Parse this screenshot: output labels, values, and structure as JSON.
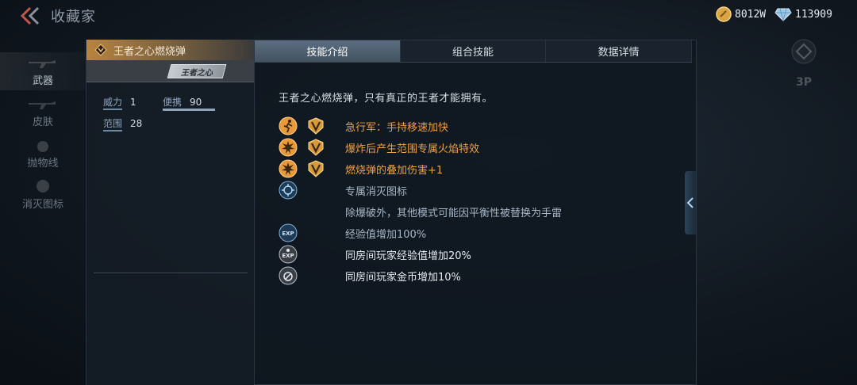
{
  "header": {
    "title": "收藏家",
    "gold": "8012W",
    "diamonds": "113909"
  },
  "nav": [
    {
      "label": "武器",
      "active": true
    },
    {
      "label": "皮肤",
      "active": false
    },
    {
      "label": "抛物线",
      "active": false
    },
    {
      "label": "消灭图标",
      "active": false
    }
  ],
  "weapon": {
    "name": "王者之心燃烧弹",
    "logo_text": "王者之心",
    "stats": {
      "power_label": "威力",
      "power_value": "1",
      "portable_label": "便携",
      "portable_value": "90",
      "range_label": "范围",
      "range_value": "28"
    }
  },
  "tabs": [
    "技能介绍",
    "组合技能",
    "数据详情"
  ],
  "side_button": "3P",
  "intro": "王者之心燃烧弹，只有真正的王者才能拥有。",
  "skills": [
    {
      "text": "急行军：手持移速加快",
      "icon": "running-icon",
      "vbadge": true,
      "color": "orange"
    },
    {
      "text": "爆炸后产生范围专属火焰特效",
      "icon": "fire-burst-icon",
      "vbadge": true,
      "color": "orange"
    },
    {
      "text": "燃烧弹的叠加伤害+1",
      "icon": "fire-burst-icon",
      "vbadge": true,
      "color": "orange"
    },
    {
      "text": "专属消灭图标",
      "icon": "kill-icon",
      "vbadge": false,
      "color": "blue"
    },
    {
      "text": "除爆破外，其他模式可能因平衡性被替换为手雷",
      "icon": "",
      "vbadge": false,
      "color": "blue"
    },
    {
      "text": "经验值增加100%",
      "icon": "exp-icon",
      "vbadge": false,
      "color": "blue"
    },
    {
      "text": "同房间玩家经验值增加20%",
      "icon": "room-exp-icon",
      "vbadge": false,
      "color": "white"
    },
    {
      "text": "同房间玩家金币增加10%",
      "icon": "room-coin-icon",
      "vbadge": false,
      "color": "white"
    }
  ],
  "colors": {
    "accent_orange": "#f0a040",
    "tab_active": "#5b6e80",
    "header_gold": "#b8843e"
  }
}
